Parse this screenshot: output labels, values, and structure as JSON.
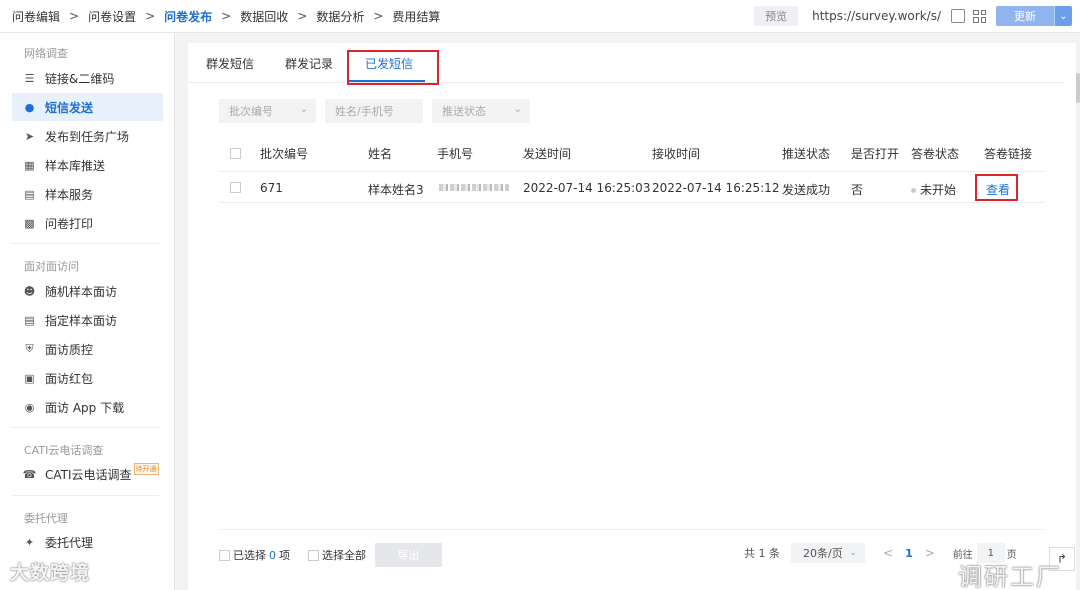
{
  "steps": [
    "问卷编辑",
    "问卷设置",
    "问卷发布",
    "数据回收",
    "数据分析",
    "费用结算"
  ],
  "active_step": "问卷发布",
  "top_right": {
    "preview": "预览",
    "url": "https://survey.work/s/",
    "update": "更新"
  },
  "sidebar": {
    "sections": [
      {
        "title": "网络调查",
        "items": [
          {
            "label": "链接&二维码",
            "icon": "layers-icon"
          },
          {
            "label": "短信发送",
            "icon": "chat-icon",
            "active": true
          },
          {
            "label": "发布到任务广场",
            "icon": "send-icon"
          },
          {
            "label": "样本库推送",
            "icon": "database-icon"
          },
          {
            "label": "样本服务",
            "icon": "service-icon"
          },
          {
            "label": "问卷打印",
            "icon": "printer-icon"
          }
        ]
      },
      {
        "title": "面对面访问",
        "items": [
          {
            "label": "随机样本面访",
            "icon": "users-icon"
          },
          {
            "label": "指定样本面访",
            "icon": "document-icon"
          },
          {
            "label": "面访质控",
            "icon": "shield-icon"
          },
          {
            "label": "面访红包",
            "icon": "redpacket-icon"
          },
          {
            "label": "面访 App 下载",
            "icon": "android-icon"
          }
        ]
      },
      {
        "title": "CATI云电话调查",
        "items": [
          {
            "label": "CATI云电话调查",
            "icon": "phone-icon",
            "badge": "待开通"
          }
        ]
      },
      {
        "title": "委托代理",
        "items": [
          {
            "label": "委托代理",
            "icon": "handshake-icon"
          }
        ]
      }
    ]
  },
  "tabs": [
    "群发短信",
    "群发记录",
    "已发短信"
  ],
  "active_tab": "已发短信",
  "filters": [
    "批次编号",
    "姓名/手机号",
    "推送状态"
  ],
  "table": {
    "headers": [
      "批次编号",
      "姓名",
      "手机号",
      "发送时间",
      "接收时间",
      "推送状态",
      "是否打开",
      "答卷状态",
      "答卷链接"
    ],
    "rows": [
      {
        "batch": "671",
        "name": "样本姓名3",
        "phone": "",
        "sent": "2022-07-14 16:25:03",
        "received": "2022-07-14 16:25:12",
        "push_status": "发送成功",
        "opened": "否",
        "answer_status": "未开始",
        "link": "查看"
      }
    ]
  },
  "footer": {
    "selected_prefix": "已选择",
    "selected_count": "0",
    "selected_suffix": "项",
    "select_all": "选择全部",
    "export": "导出",
    "total": "共 1 条",
    "page_size": "20条/页",
    "current_page": "1",
    "jump_label": "前往",
    "jump_value": "1",
    "jump_suffix": "页"
  },
  "watermarks": {
    "left": "大数跨境",
    "right": "调研工厂"
  },
  "colors": {
    "accent": "#1f6fd6",
    "highlight_box": "#d9262c"
  }
}
